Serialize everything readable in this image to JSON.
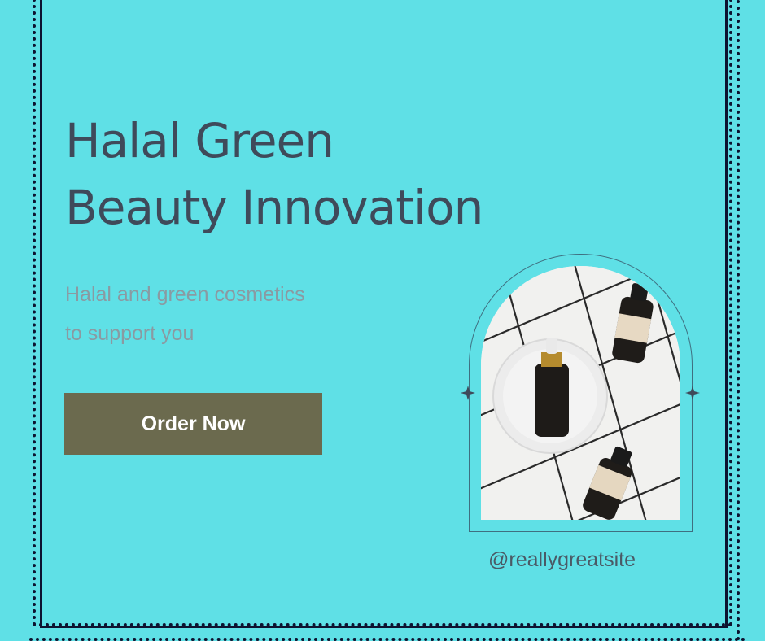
{
  "headline": {
    "line1": "Halal Green",
    "line2": "Beauty Innovation"
  },
  "subheadline": {
    "line1": "Halal and green cosmetics",
    "line2": "to support you"
  },
  "cta": {
    "label": "Order Now"
  },
  "social": {
    "handle": "@reallygreatsite"
  },
  "colors": {
    "background": "#5fe0e6",
    "border": "#0d1330",
    "headline": "#3f4a5a",
    "subheadline": "#8a9aa2",
    "button": "#6b6a4e",
    "button_text": "#ffffff"
  },
  "icons": {
    "sparkle": "four-point-star-icon"
  }
}
